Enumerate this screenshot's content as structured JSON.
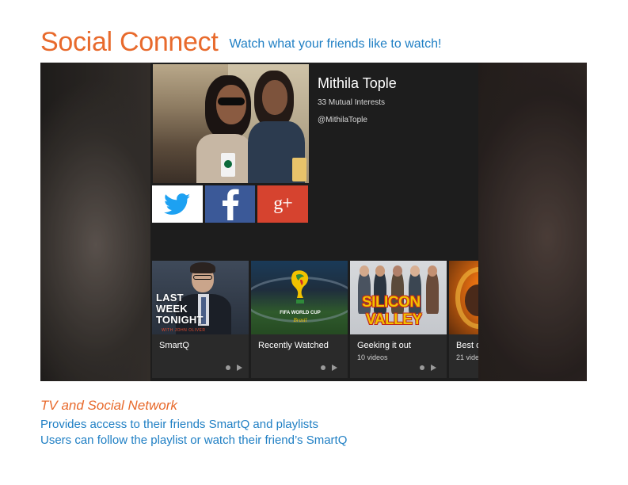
{
  "header": {
    "title": "Social Connect",
    "tagline": "Watch what your friends like to watch!"
  },
  "profile": {
    "name": "Mithila Tople",
    "mutual": "33 Mutual Interests",
    "handle": "@MithilaTople",
    "social_icons": [
      "twitter-icon",
      "facebook-icon",
      "google-plus-icon"
    ],
    "gplus_text": "g+",
    "facebook_glyph": "f"
  },
  "shelves": [
    {
      "label": "SmartQ",
      "sub": "",
      "thumb_logo_lines": [
        "LAST",
        "WEEK",
        "TONIGHT"
      ],
      "thumb_sub": "WITH JOHN OLIVER"
    },
    {
      "label": "Recently Watched",
      "sub": "",
      "thumb_logo": "FIFA WORLD CUP",
      "thumb_sub": "Brasil"
    },
    {
      "label": "Geeking it out",
      "sub": "10 videos",
      "thumb_logo_lines": [
        "SILICON",
        "VALLEY"
      ]
    },
    {
      "label": "Best o",
      "sub": "21 vide"
    }
  ],
  "footer": {
    "title": "TV and Social Network",
    "line1": "Provides access to their friends SmartQ and playlists",
    "line2": "Users can follow the playlist or watch their friend’s SmartQ"
  },
  "colors": {
    "accent_orange": "#e86a2c",
    "accent_blue": "#1f7fc4",
    "panel_bg": "#1d1d1d",
    "twitter": "#1da1f2",
    "facebook": "#3b5998",
    "google_plus": "#d6432f"
  }
}
